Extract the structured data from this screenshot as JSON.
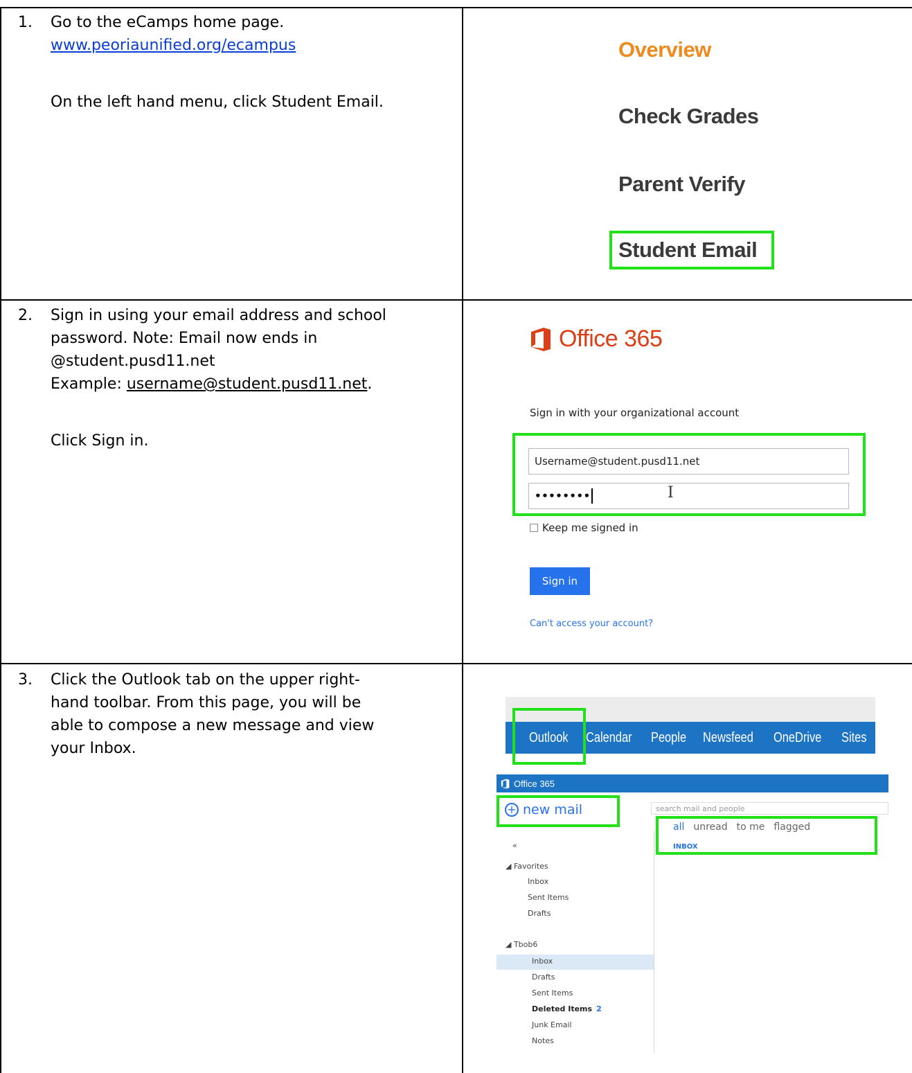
{
  "steps": [
    {
      "number": "1.",
      "line1": "Go to the eCamps home page.",
      "link": "www.peoriaunified.org/ecampus",
      "line2": "On the left hand menu, click Student Email."
    },
    {
      "number": "2.",
      "line1": "Sign in using your email address and school",
      "line2": "password.  Note:  Email now ends in",
      "line3": "@student.pusd11.net",
      "example_label": "Example: ",
      "example_value": "username@student.pusd11.net",
      "example_end": ".",
      "line5": "Click Sign in."
    },
    {
      "number": "3.",
      "line1": "Click the Outlook tab on the upper right-",
      "line2": "hand toolbar.  From this page, you will be",
      "line3": "able to compose a new message and view",
      "line4": "your Inbox."
    }
  ],
  "ecampus_menu": {
    "items": [
      "Overview",
      "Check Grades",
      "Parent Verify",
      "Student Email"
    ],
    "active_color": "#ef8a1e",
    "highlight_color": "#22e01a"
  },
  "login": {
    "logo_text": "Office 365",
    "heading": "Sign in with your organizational account",
    "username_value": "Username@student.pusd11.net",
    "password_value": "••••••••",
    "keep_signed_in": "Keep me signed in",
    "signin_button": "Sign in",
    "cant_access": "Can't access your account?"
  },
  "outlook": {
    "nav_items": [
      "Outlook",
      "Calendar",
      "People",
      "Newsfeed",
      "OneDrive",
      "Sites",
      "•••"
    ],
    "office_bar": "Office 365",
    "new_mail": "new mail",
    "search_placeholder": "search mail and people",
    "filters": [
      "all",
      "unread",
      "to me",
      "flagged"
    ],
    "inbox_header": "INBOX",
    "collapse": "«",
    "favorites_header": "◢ Favorites",
    "favorites": [
      "Inbox",
      "Sent Items",
      "Drafts"
    ],
    "account_header": "◢ Tbob6",
    "folders": [
      "Inbox",
      "Drafts",
      "Sent Items",
      "Deleted Items",
      "Junk Email",
      "Notes"
    ],
    "deleted_count": "2"
  }
}
